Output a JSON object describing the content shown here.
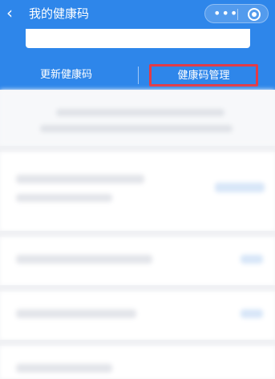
{
  "nav": {
    "back_icon": "chevron-left-icon",
    "title": "我的健康码",
    "more_icon": "more-dots-icon",
    "close_icon": "target-circle-icon"
  },
  "actions": {
    "update_label": "更新健康码",
    "manage_label": "健康码管理",
    "highlight_color": "#e23b47"
  },
  "colors": {
    "brand_blue": "#2e86ea",
    "background": "#f5f6f8"
  }
}
